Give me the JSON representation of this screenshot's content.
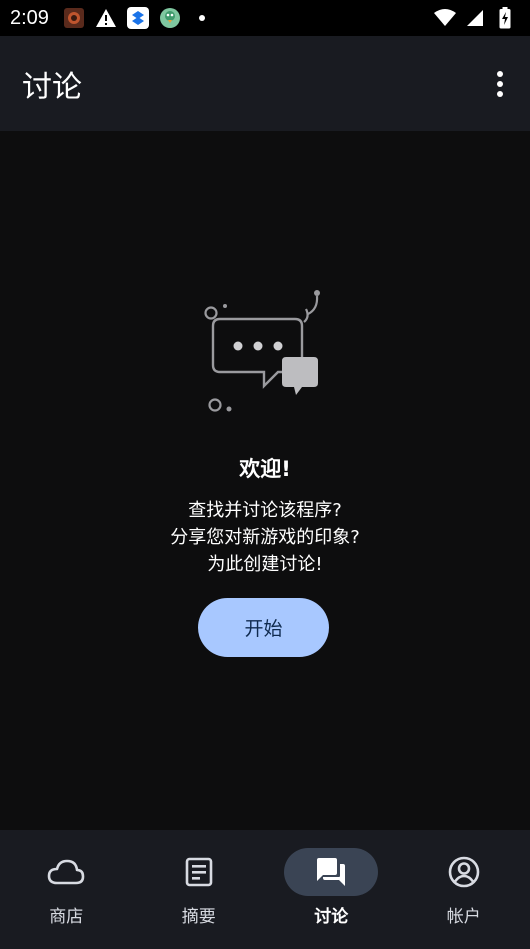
{
  "status_bar": {
    "time": "2:09",
    "left_icons": [
      "app-notification-icon",
      "warning-icon",
      "dropbox-icon",
      "bird-app-icon",
      "more-notifications-dot"
    ],
    "right_icons": [
      "wifi-icon",
      "signal-icon",
      "battery-charging-icon"
    ]
  },
  "app_bar": {
    "title": "讨论",
    "menu_icon": "more-vert-icon"
  },
  "empty_state": {
    "illustration_icon": "chat-bubbles-icon",
    "title": "欢迎!",
    "lines": [
      "查找并讨论该程序?",
      "分享您对新游戏的印象?",
      "为此创建讨论!"
    ],
    "button_label": "开始"
  },
  "bottom_nav": {
    "items": [
      {
        "label": "商店",
        "icon": "cloud-icon",
        "active": false
      },
      {
        "label": "摘要",
        "icon": "feed-icon",
        "active": false
      },
      {
        "label": "讨论",
        "icon": "forum-icon",
        "active": true
      },
      {
        "label": "帐户",
        "icon": "account-circle-icon",
        "active": false
      }
    ]
  },
  "colors": {
    "background": "#0d0d0e",
    "bar": "#191b21",
    "accent_button": "#a8c8ff",
    "active_pill": "#3a4454"
  }
}
